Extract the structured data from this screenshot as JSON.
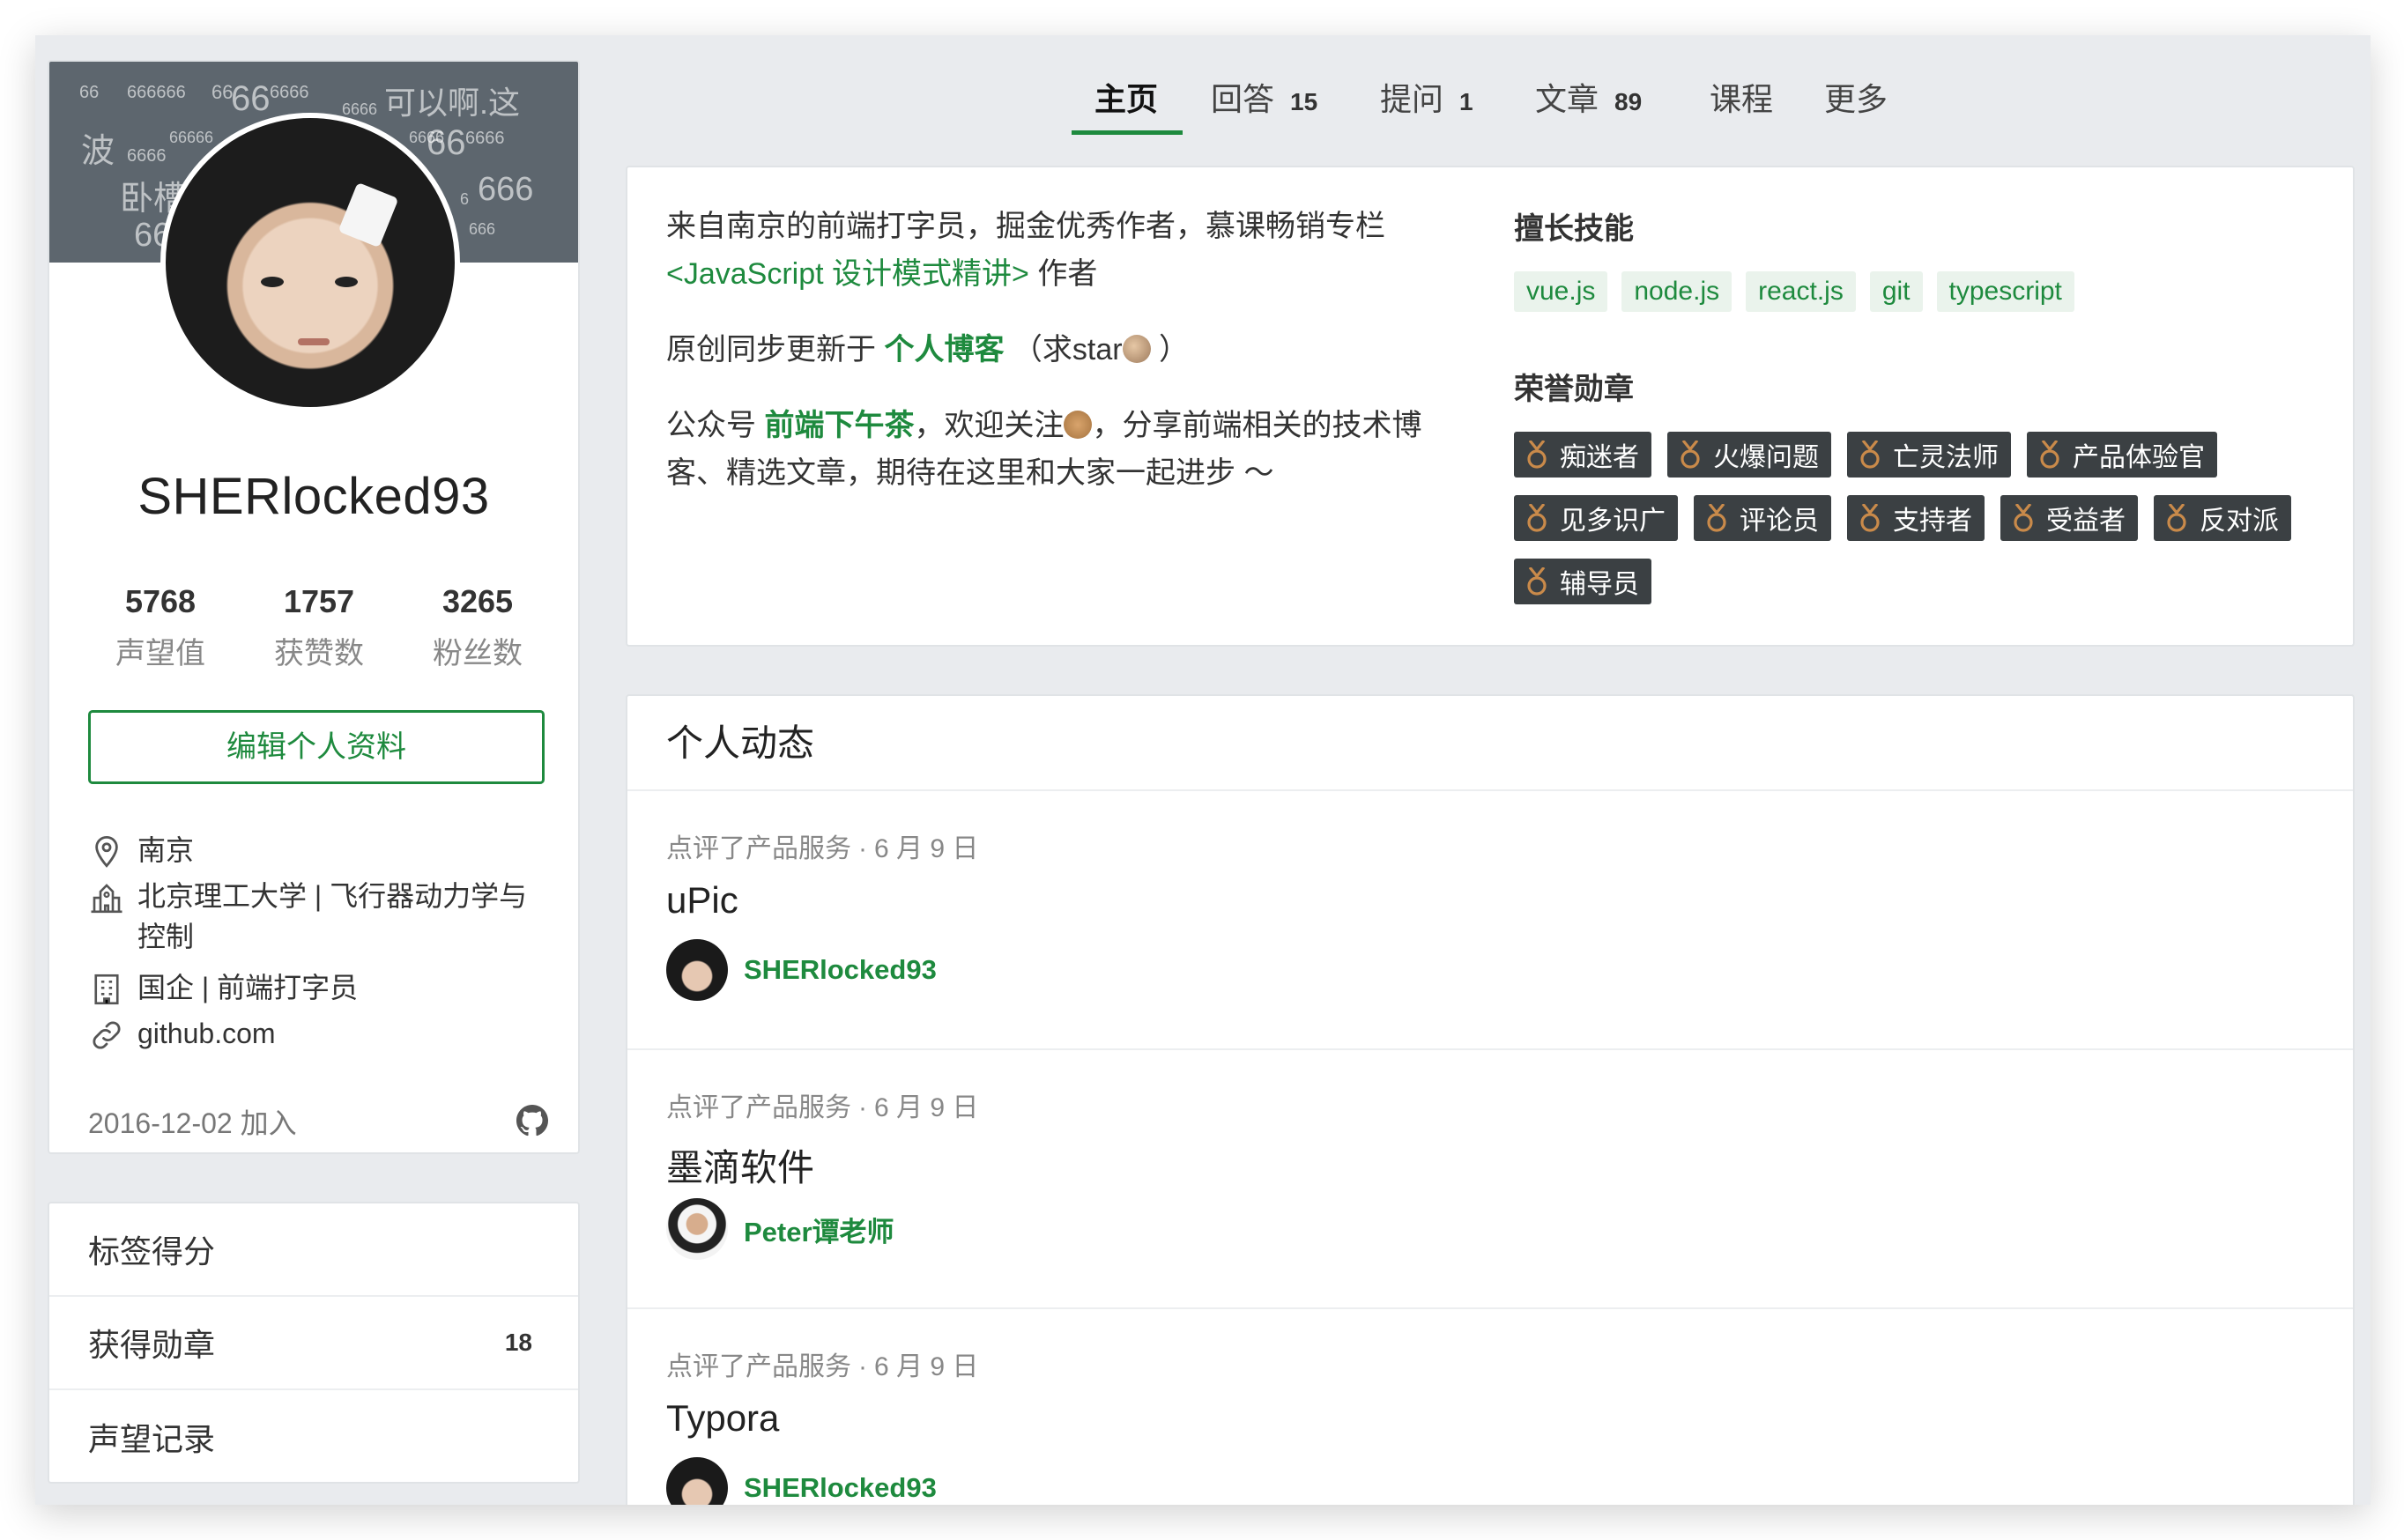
{
  "cover_text": [
    "66",
    "666666",
    "66",
    "66",
    "6666",
    "6666",
    "可以啊.这",
    "波",
    "6666",
    "66666",
    "6666",
    "66",
    "6666",
    "卧槽",
    "6",
    "666",
    "66",
    "666"
  ],
  "profile": {
    "username": "SHERlocked93",
    "stats": [
      {
        "value": "5768",
        "label": "声望值"
      },
      {
        "value": "1757",
        "label": "获赞数"
      },
      {
        "value": "3265",
        "label": "粉丝数"
      }
    ],
    "edit_button": "编辑个人资料",
    "location": "南京",
    "school": "北京理工大学 | 飞行器动力学与控制",
    "company": "国企 | 前端打字员",
    "website": "github.com",
    "joined": "2016-12-02 加入"
  },
  "side_menu": [
    {
      "label": "标签得分",
      "count": ""
    },
    {
      "label": "获得勋章",
      "count": "18"
    },
    {
      "label": "声望记录",
      "count": ""
    }
  ],
  "tabs": [
    {
      "label": "主页",
      "count": ""
    },
    {
      "label": "回答",
      "count": "15"
    },
    {
      "label": "提问",
      "count": "1"
    },
    {
      "label": "文章",
      "count": "89"
    },
    {
      "label": "课程",
      "count": ""
    },
    {
      "label": "更多",
      "count": ""
    }
  ],
  "bio": {
    "line1_a": "来自南京的前端打字员，掘金优秀作者，慕课畅销专栏",
    "line1_link": "<JavaScript 设计模式精讲>",
    "line1_b": " 作者",
    "line2_a": "原创同步更新于 ",
    "line2_link": "个人博客",
    "line2_b": " （求star",
    "line2_c": " ）",
    "line3_a": "公众号 ",
    "line3_link": "前端下午茶",
    "line3_b": "，欢迎关注",
    "line3_c": "，分享前端相关的技术博客、精选文章，期待在这里和大家一起进步 ～"
  },
  "skills_title": "擅长技能",
  "skills": [
    "vue.js",
    "node.js",
    "react.js",
    "git",
    "typescript"
  ],
  "badges_title": "荣誉勋章",
  "badges": [
    "痴迷者",
    "火爆问题",
    "亡灵法师",
    "产品体验官",
    "见多识广",
    "评论员",
    "支持者",
    "受益者",
    "反对派",
    "辅导员"
  ],
  "feed": {
    "title": "个人动态",
    "items": [
      {
        "action": "点评了产品服务",
        "date": "6 月 9 日",
        "title": "uPic",
        "author": "SHERlocked93",
        "avatar": "sher"
      },
      {
        "action": "点评了产品服务",
        "date": "6 月 9 日",
        "title": "墨滴软件",
        "author": "Peter谭老师",
        "avatar": "peter"
      },
      {
        "action": "点评了产品服务",
        "date": "6 月 9 日",
        "title": "Typora",
        "author": "SHERlocked93",
        "avatar": "sher"
      }
    ]
  },
  "colors": {
    "brand_green": "#1e8a3e",
    "badge_bg": "#3b4043",
    "medal": "#c98a4a"
  }
}
